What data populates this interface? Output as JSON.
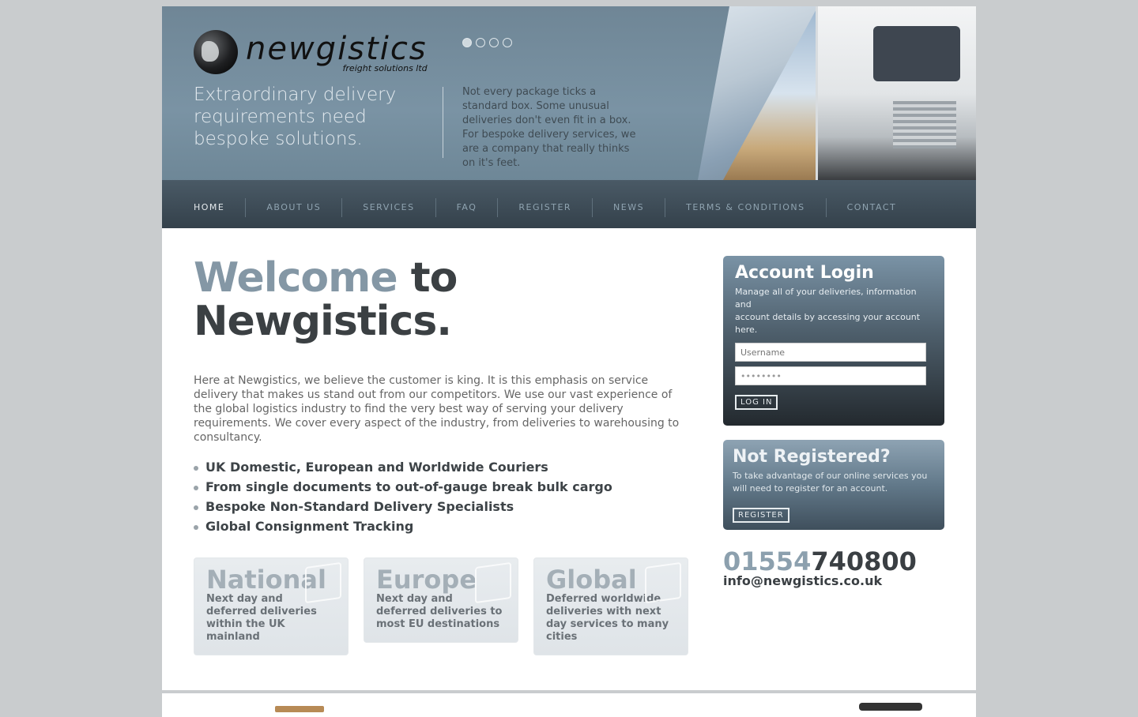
{
  "brand": {
    "name": "newgistics",
    "sub": "freight solutions ltd"
  },
  "hero": {
    "tagline": "Extraordinary delivery requirements need bespoke solutions.",
    "intro": "Not every package ticks a standard box. Some unusual deliveries don't even fit in a box. For bespoke delivery services, we are a company that really thinks on it's feet.",
    "slides": 4,
    "active_slide": 1
  },
  "nav": {
    "items": [
      "HOME",
      "ABOUT US",
      "SERVICES",
      "FAQ",
      "REGISTER",
      "NEWS",
      "TERMS & CONDITIONS",
      "CONTACT"
    ]
  },
  "welcome": {
    "highlight": "Welcome",
    "rest": " to",
    "line2": "Newgistics."
  },
  "lead": "Here at Newgistics, we believe the customer is king. It is this emphasis on service delivery that makes us stand out from our competitors. We use our vast experience of the global logistics industry to find the very best way of serving your delivery requirements. We cover every aspect of the industry, from deliveries to warehousing to consultancy.",
  "bullets": [
    "UK Domestic, European and Worldwide Couriers",
    "From single documents to out-of-gauge break bulk cargo",
    "Bespoke Non-Standard Delivery Specialists",
    "Global Consignment Tracking"
  ],
  "tiles": [
    {
      "title": "National",
      "desc": "Next day and deferred deliveries within the UK mainland"
    },
    {
      "title": "Europe",
      "desc": "Next day and deferred deliveries to most EU destinations"
    },
    {
      "title": "Global",
      "desc": "Deferred worldwide deliveries with next day services to many cities"
    }
  ],
  "login": {
    "title": "Account Login",
    "desc1": "Manage all of your deliveries, information and",
    "desc2": "account details by accessing your account here.",
    "username_placeholder": "Username",
    "password_value": "••••••••",
    "button": "LOG IN"
  },
  "notreg": {
    "title": "Not Registered?",
    "desc": "To take advantage of our online services you will need to register for an account.",
    "button": "REGISTER"
  },
  "contact": {
    "phone_hl": "01554",
    "phone_rest": "740800",
    "email": "info@newgistics.co.uk"
  }
}
